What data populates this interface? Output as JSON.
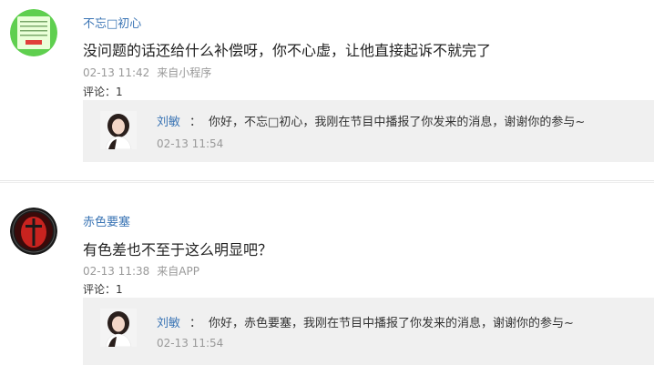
{
  "comments": [
    {
      "username": "不忘□初心",
      "content": "没问题的话还给什么补偿呀，你不心虚，让他直接起诉不就完了",
      "time": "02-13 11:42",
      "source": "来自小程序",
      "comment_count": "评论：1",
      "reply": {
        "author": "刘敏",
        "separator": "：",
        "text": "你好，不忘□初心，我刚在节目中播报了你发来的消息，谢谢你的参与~",
        "time": "02-13 11:54"
      }
    },
    {
      "username": "赤色要塞",
      "content": "有色差也不至于这么明显吧？",
      "time": "02-13 11:38",
      "source": "来自APP",
      "comment_count": "评论：1",
      "reply": {
        "author": "刘敏",
        "separator": "：",
        "text": "你好，赤色要塞，我刚在节目中播报了你发来的消息，谢谢你的参与~",
        "time": "02-13 11:54"
      }
    }
  ],
  "colors": {
    "link": "#3b75b5",
    "meta": "#999999",
    "reply_bg": "#f0f0f0"
  }
}
